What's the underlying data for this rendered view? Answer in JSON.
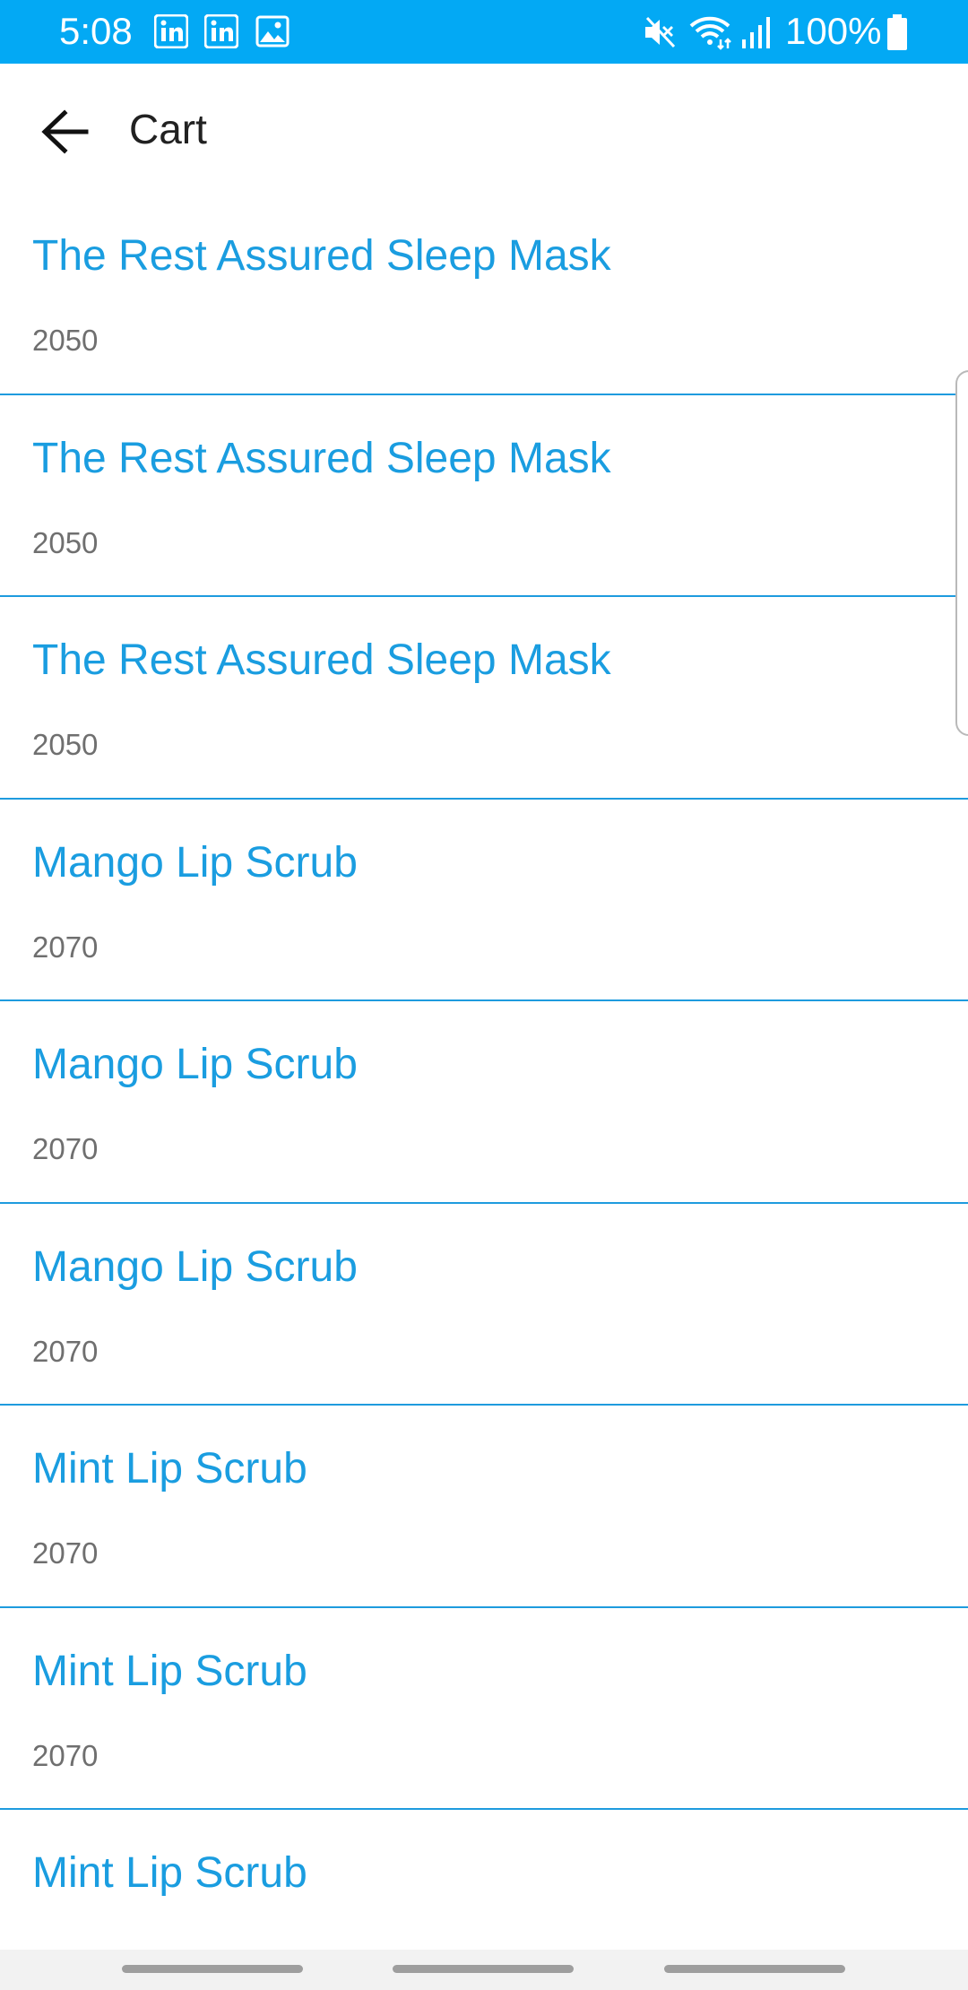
{
  "status_bar": {
    "time": "5:08",
    "battery_text": "100%",
    "background_color": "#03A9F4",
    "left_icons": [
      "linkedin-icon",
      "linkedin-icon",
      "image-icon"
    ],
    "right_icons": [
      "mute-icon",
      "wifi-icon",
      "signal-icon",
      "battery-icon"
    ]
  },
  "app_bar": {
    "back_icon": "arrow-left-icon",
    "title": "Cart"
  },
  "cart": {
    "items": [
      {
        "name": "The Rest Assured Sleep Mask",
        "price": "2050"
      },
      {
        "name": "The Rest Assured Sleep Mask",
        "price": "2050"
      },
      {
        "name": "The Rest Assured Sleep Mask",
        "price": "2050"
      },
      {
        "name": "Mango Lip Scrub",
        "price": "2070"
      },
      {
        "name": "Mango Lip Scrub",
        "price": "2070"
      },
      {
        "name": "Mango Lip Scrub",
        "price": "2070"
      },
      {
        "name": "Mint Lip Scrub",
        "price": "2070"
      },
      {
        "name": "Mint Lip Scrub",
        "price": "2070"
      },
      {
        "name": "Mint Lip Scrub",
        "price": ""
      }
    ],
    "name_color": "#1A9DE0",
    "divider_color": "#1E9BDE"
  }
}
